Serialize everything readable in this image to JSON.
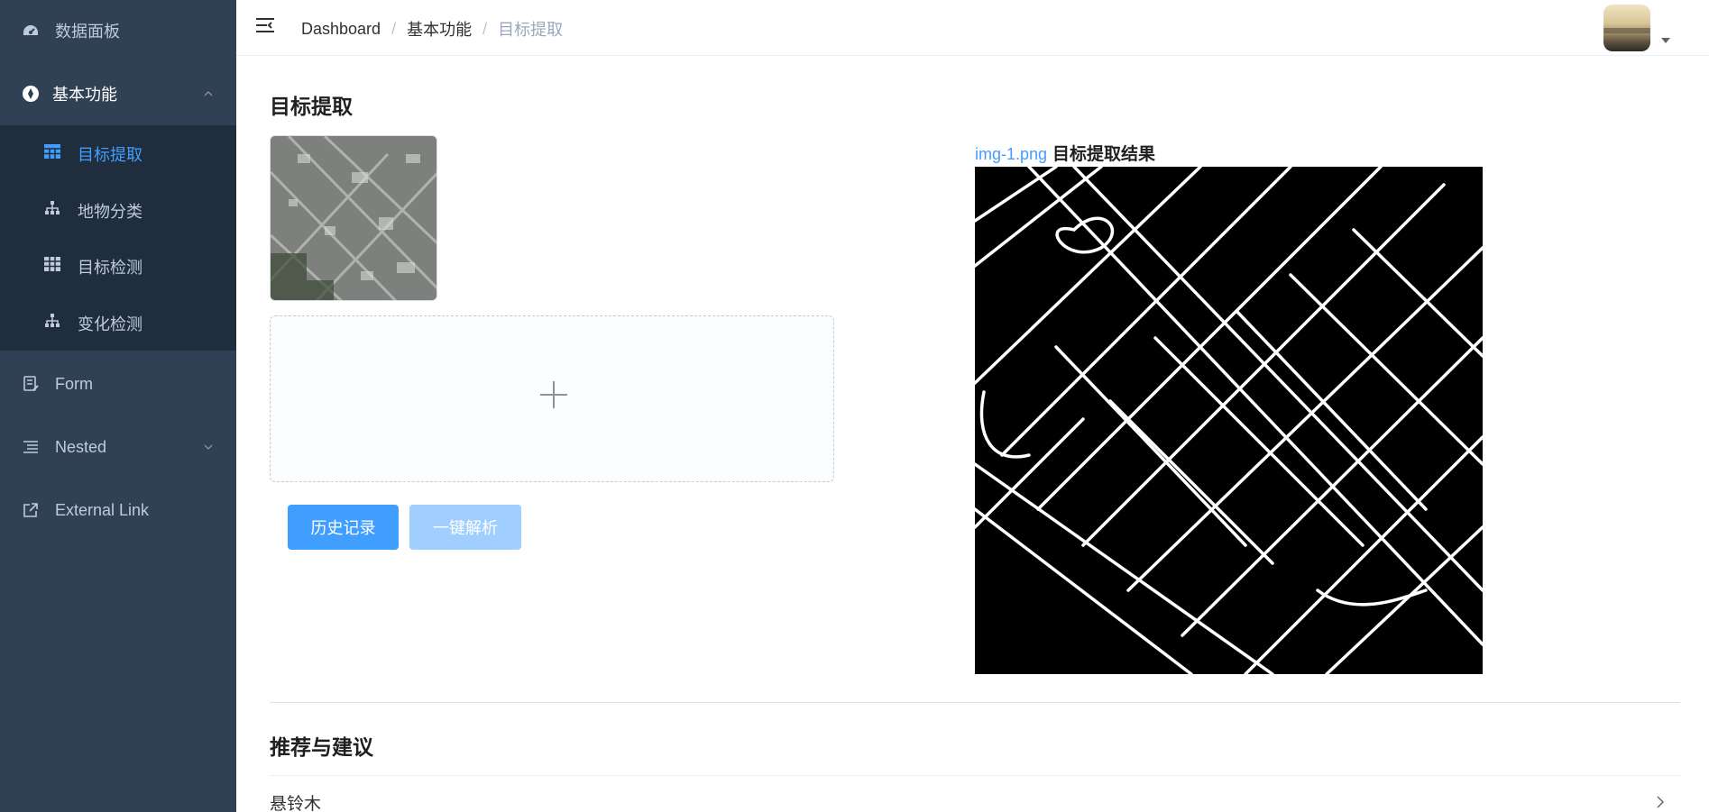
{
  "sidebar": {
    "items": [
      {
        "label": "数据面板",
        "icon": "dashboard-icon"
      },
      {
        "label": "基本功能",
        "icon": "circle-nav-icon"
      },
      {
        "label": "Form",
        "icon": "form-icon"
      },
      {
        "label": "Nested",
        "icon": "nested-list-icon"
      },
      {
        "label": "External Link",
        "icon": "external-link-icon"
      }
    ],
    "submenu": [
      {
        "label": "目标提取",
        "icon": "table-grid-icon",
        "active": true
      },
      {
        "label": "地物分类",
        "icon": "tree-icon"
      },
      {
        "label": "目标检测",
        "icon": "table-grid-icon"
      },
      {
        "label": "变化检测",
        "icon": "tree-icon"
      }
    ]
  },
  "breadcrumb": [
    "Dashboard",
    "基本功能",
    "目标提取"
  ],
  "main": {
    "title": "目标提取",
    "buttons": {
      "history": "历史记录",
      "analyze": "一键解析"
    },
    "result": {
      "filename": "img-1.png",
      "title": "目标提取结果"
    },
    "recommend_title": "推荐与建议",
    "recommend_items": [
      "悬铃木"
    ]
  },
  "colors": {
    "sidebar": "#304156",
    "submenu": "#1f2d3d",
    "accent": "#409eff",
    "disabled": "#a0cfff"
  }
}
